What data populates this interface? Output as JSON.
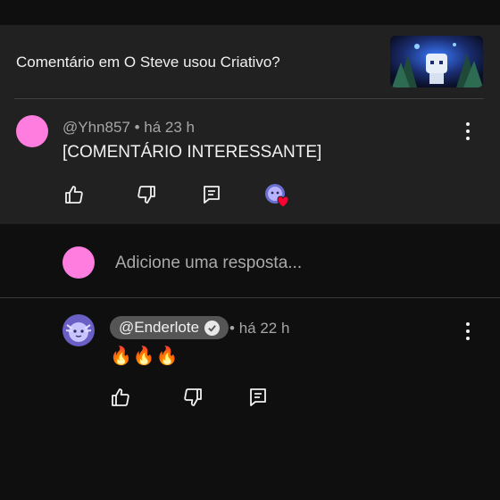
{
  "context": {
    "title": "Comentário em O Steve usou Criativo?"
  },
  "comment": {
    "author": "@Yhn857",
    "time": "há 23 h",
    "text": "[COMENTÁRIO INTERESSANTE]",
    "avatar_color": "#ff7ddf"
  },
  "reply_box": {
    "placeholder": "Adicione uma resposta..."
  },
  "reply": {
    "author": "@Enderlote",
    "time": "há 22 h",
    "text": "🔥🔥🔥",
    "verified": true
  },
  "icons": {
    "like": "thumbs-up-icon",
    "dislike": "thumbs-down-icon",
    "reply": "reply-icon",
    "more": "more-vertical-icon",
    "heart": "creator-heart-icon"
  },
  "colors": {
    "panel": "#212121",
    "background": "#0f0f0f",
    "heart": "#ff0033"
  }
}
